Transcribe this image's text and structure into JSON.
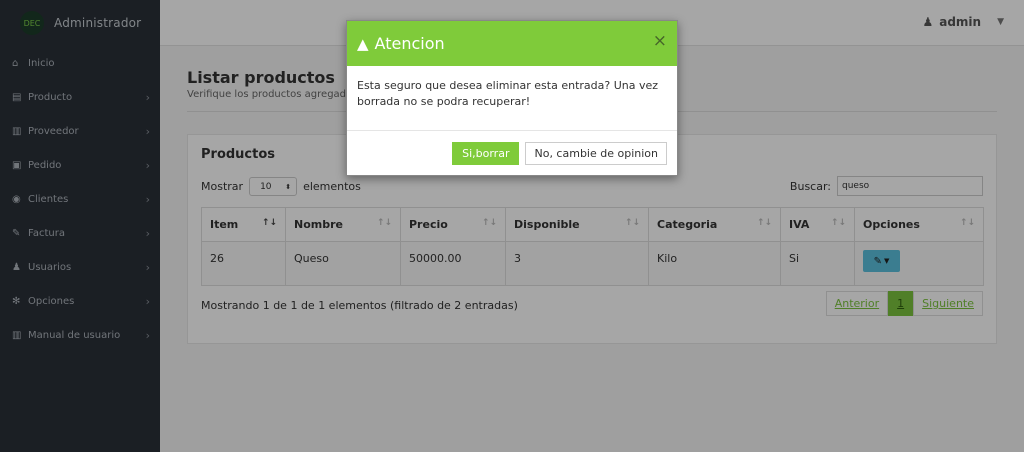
{
  "app": {
    "logo_text": "DEC",
    "title": "Administrador"
  },
  "topbar": {
    "user": "admin"
  },
  "sidebar": {
    "items": [
      {
        "label": "Inicio",
        "icon": "home-icon",
        "glyph": "⌂",
        "chevron": false
      },
      {
        "label": "Producto",
        "icon": "box-icon",
        "glyph": "▤",
        "chevron": true
      },
      {
        "label": "Proveedor",
        "icon": "book-icon",
        "glyph": "▥",
        "chevron": true
      },
      {
        "label": "Pedido",
        "icon": "gift-icon",
        "glyph": "▣",
        "chevron": true
      },
      {
        "label": "Clientes",
        "icon": "eye-icon",
        "glyph": "◉",
        "chevron": true
      },
      {
        "label": "Factura",
        "icon": "wrench-icon",
        "glyph": "✎",
        "chevron": true
      },
      {
        "label": "Usuarios",
        "icon": "users-icon",
        "glyph": "♟",
        "chevron": true
      },
      {
        "label": "Opciones",
        "icon": "gear-icon",
        "glyph": "✻",
        "chevron": true
      },
      {
        "label": "Manual de usuario",
        "icon": "book-icon",
        "glyph": "▥",
        "chevron": true
      }
    ]
  },
  "page": {
    "title": "Listar productos",
    "subtitle": "Verifique los productos agregados"
  },
  "panel": {
    "title": "Productos",
    "show_label": "Mostrar",
    "page_size": "10",
    "entries_label": "elementos",
    "search_label": "Buscar:",
    "search_value": "queso"
  },
  "table": {
    "columns": [
      "Item",
      "Nombre",
      "Precio",
      "Disponible",
      "Categoria",
      "IVA",
      "Opciones"
    ],
    "rows": [
      {
        "item": "26",
        "nombre": "Queso",
        "precio": "50000.00",
        "disponible": "3",
        "categoria": "Kilo",
        "iva": "Si"
      }
    ]
  },
  "footer": {
    "info": "Mostrando 1 de 1 de 1 elementos (filtrado de 2 entradas)",
    "prev": "Anterior",
    "page": "1",
    "next": "Siguiente"
  },
  "modal": {
    "title": "Atencion",
    "message": "Esta seguro que desea eliminar esta entrada? Una vez borrada no se podra recuperar!",
    "confirm": "Si,borrar",
    "cancel": "No, cambie de opinion",
    "close": "×"
  },
  "colors": {
    "accent": "#7fcb3a",
    "sidebar": "#2a3038",
    "option_button": "#5bc0de"
  }
}
